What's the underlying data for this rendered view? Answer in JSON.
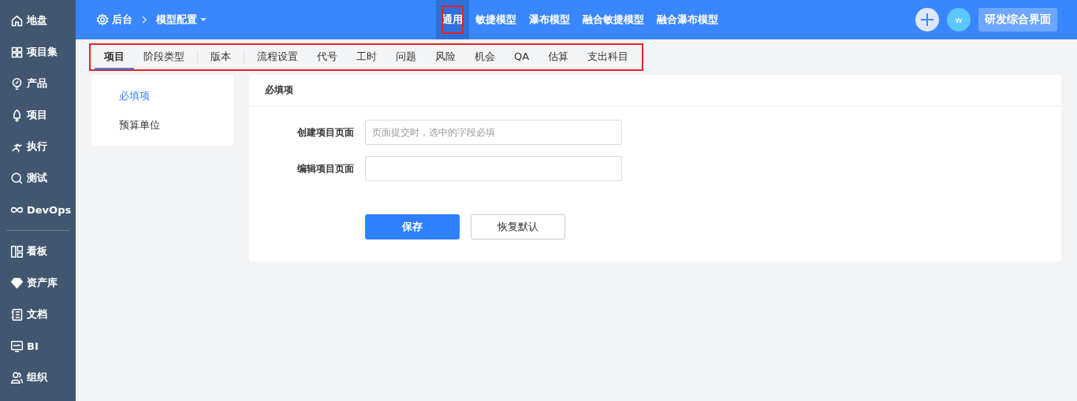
{
  "sidebar": {
    "items": [
      {
        "label": "地盘",
        "divider_before": false
      },
      {
        "label": "项目集",
        "divider_before": false
      },
      {
        "label": "产品",
        "divider_before": false
      },
      {
        "label": "项目",
        "divider_before": false
      },
      {
        "label": "执行",
        "divider_before": false
      },
      {
        "label": "测试",
        "divider_before": false
      },
      {
        "label": "DevOps",
        "divider_before": false
      },
      {
        "label": "看板",
        "divider_before": true
      },
      {
        "label": "资产库",
        "divider_before": false
      },
      {
        "label": "文档",
        "divider_before": false
      },
      {
        "label": "BI",
        "divider_before": false
      },
      {
        "label": "组织",
        "divider_before": false
      }
    ]
  },
  "breadcrumb": {
    "root": "后台",
    "current": "模型配置"
  },
  "model_tabs": [
    {
      "label": "通用",
      "selected": true,
      "highlighted": true
    },
    {
      "label": "敏捷模型",
      "selected": false,
      "highlighted": false
    },
    {
      "label": "瀑布模型",
      "selected": false,
      "highlighted": false
    },
    {
      "label": "融合敏捷模型",
      "selected": false,
      "highlighted": false
    },
    {
      "label": "融合瀑布模型",
      "selected": false,
      "highlighted": false
    }
  ],
  "header_right": {
    "avatar": "w",
    "app_button": "研发综合界面"
  },
  "sub_tabs": {
    "highlighted": true,
    "items": [
      {
        "label": "项目",
        "selected": true,
        "divider_after": false
      },
      {
        "label": "阶段类型",
        "selected": false,
        "divider_after": true
      },
      {
        "label": "版本",
        "selected": false,
        "divider_after": true
      },
      {
        "label": "流程设置",
        "selected": false,
        "divider_after": false
      },
      {
        "label": "代号",
        "selected": false,
        "divider_after": false
      },
      {
        "label": "工时",
        "selected": false,
        "divider_after": false
      },
      {
        "label": "问题",
        "selected": false,
        "divider_after": false
      },
      {
        "label": "风险",
        "selected": false,
        "divider_after": false
      },
      {
        "label": "机会",
        "selected": false,
        "divider_after": false
      },
      {
        "label": "QA",
        "selected": false,
        "divider_after": false
      },
      {
        "label": "估算",
        "selected": false,
        "divider_after": false
      },
      {
        "label": "支出科目",
        "selected": false,
        "divider_after": false
      }
    ]
  },
  "side_menu": [
    {
      "label": "必填项",
      "selected": true
    },
    {
      "label": "预算单位",
      "selected": false
    }
  ],
  "panel": {
    "title": "必填项",
    "fields": [
      {
        "label": "创建项目页面",
        "placeholder": "页面提交时，选中的字段必填"
      },
      {
        "label": "编辑项目页面"
      }
    ],
    "buttons": [
      {
        "label": "保存",
        "kind": "primary"
      },
      {
        "label": "恢复默认",
        "kind": "default"
      }
    ]
  }
}
